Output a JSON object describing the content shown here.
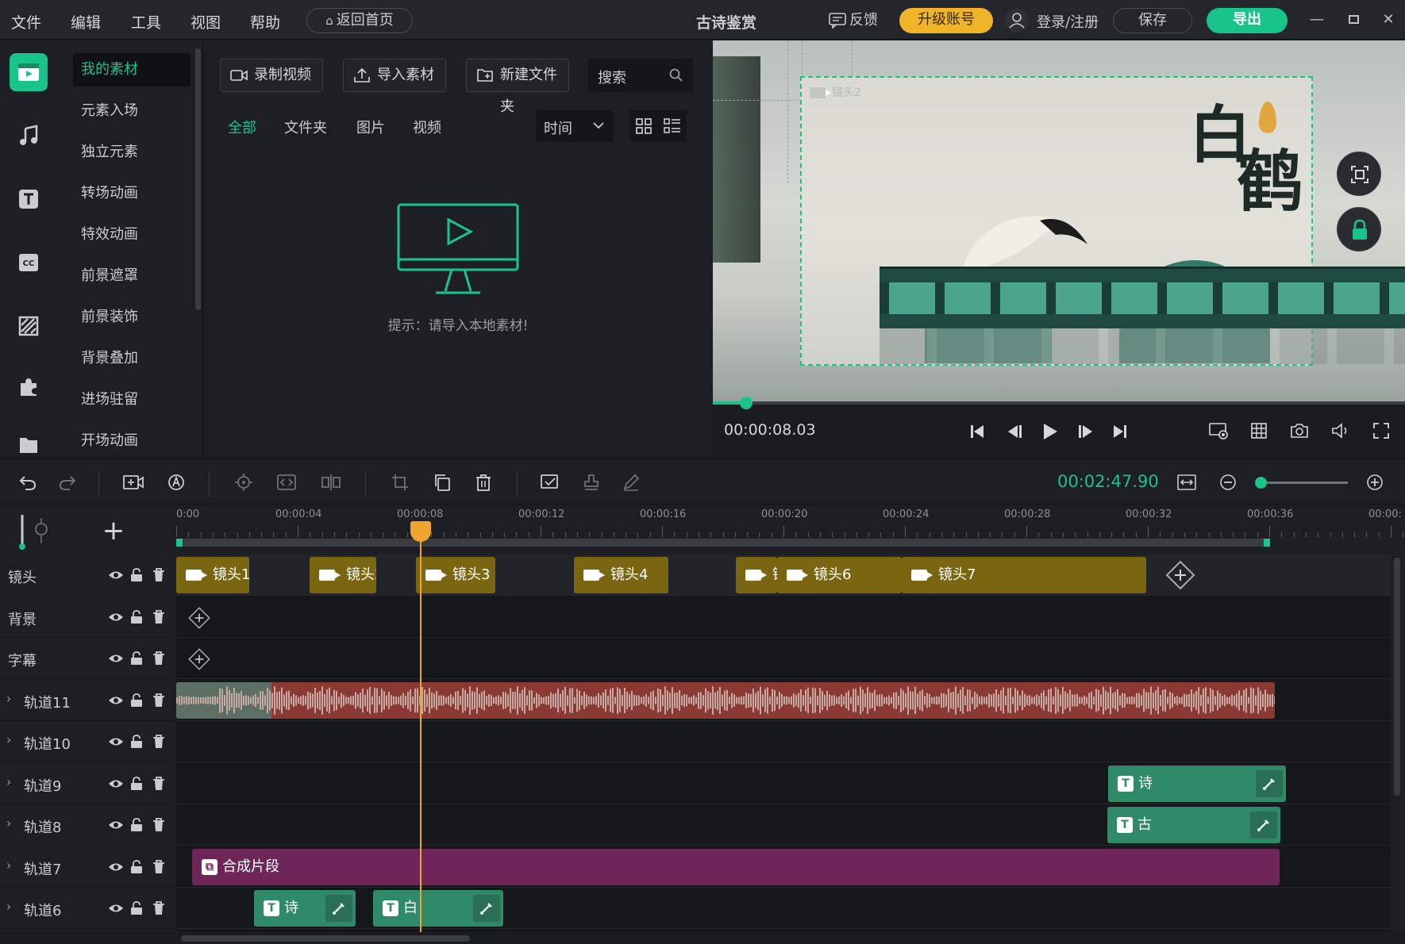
{
  "menu": {
    "file": "文件",
    "edit": "编辑",
    "tools": "工具",
    "view": "视图",
    "help": "帮助",
    "back_home": "返回首页"
  },
  "project_title": "古诗鉴赏",
  "header_actions": {
    "feedback": "反馈",
    "upgrade": "升级账号",
    "login": "登录/注册",
    "save": "保存",
    "export": "导出"
  },
  "categories": [
    "我的素材",
    "元素入场",
    "独立元素",
    "转场动画",
    "特效动画",
    "前景遮罩",
    "前景装饰",
    "背景叠加",
    "进场驻留",
    "开场动画"
  ],
  "media": {
    "record": "录制视频",
    "import": "导入素材",
    "new_folder": "新建文件夹",
    "search_placeholder": "搜索",
    "tabs": [
      "全部",
      "文件夹",
      "图片",
      "视频"
    ],
    "sort": "时间",
    "hint": "提示：请导入本地素材!"
  },
  "preview": {
    "shot_label": "镜头2",
    "title_char1": "白",
    "title_char2": "鹤",
    "current_time": "00:00:08.03"
  },
  "timeline": {
    "total_time": "00:02:47.90",
    "zoom_level": 0.05,
    "playhead_time": "00:00:08",
    "ruler": [
      "0:00",
      "00:00:04",
      "00:00:08",
      "00:00:12",
      "00:00:16",
      "00:00:20",
      "00:00:24",
      "00:00:28",
      "00:00:32",
      "00:00:36",
      "00:00:"
    ],
    "tracks": [
      "镜头",
      "背景",
      "字幕",
      "轨道11",
      "轨道10",
      "轨道9",
      "轨道8",
      "轨道7",
      "轨道6"
    ],
    "shots": [
      "镜头1",
      "镜头2",
      "镜头3",
      "镜头4",
      "镜",
      "镜头6",
      "镜头7"
    ],
    "text_clips": {
      "t9": "诗",
      "t8": "古",
      "t6a": "诗",
      "t6b": "白"
    },
    "compound": "合成片段"
  },
  "colors": {
    "accent": "#19c48a",
    "upgrade": "#f0b429",
    "video_clip": "#7a6510",
    "text_clip": "#2f8a68",
    "compound_clip": "#6e2558",
    "audio_clip": "#8a3a32",
    "playhead": "#f0a531"
  }
}
